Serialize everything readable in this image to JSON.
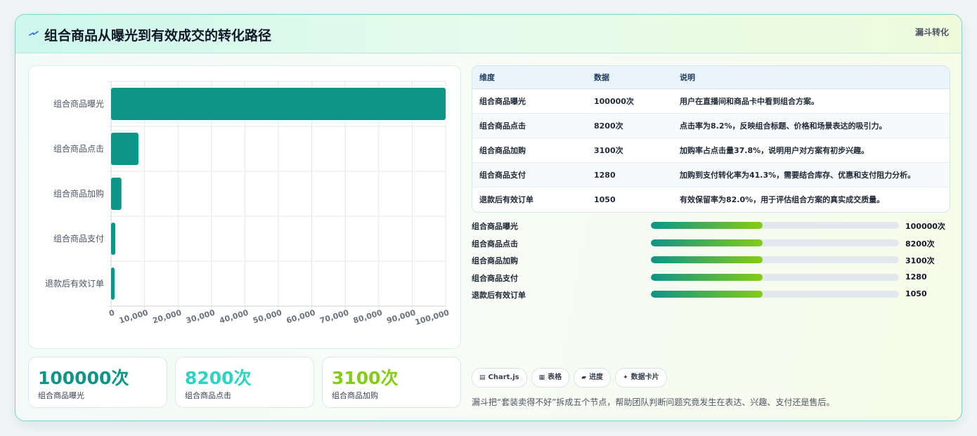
{
  "header": {
    "title": "组合商品从曝光到有效成交的转化路径",
    "badge": "漏斗转化",
    "icon": "spark-icon"
  },
  "colors": {
    "bar": "#0f9488",
    "kpi1": "#0f9488",
    "kpi2": "#2dd4bf",
    "kpi3": "#84cc16",
    "progress_start": "#0f9488",
    "progress_end": "#84cc16"
  },
  "chart_data": {
    "type": "bar",
    "orientation": "horizontal",
    "categories": [
      "组合商品曝光",
      "组合商品点击",
      "组合商品加购",
      "组合商品支付",
      "退款后有效订单"
    ],
    "values": [
      100000,
      8200,
      3100,
      1280,
      1050
    ],
    "xlim": [
      0,
      100000
    ],
    "xticks": [
      0,
      10000,
      20000,
      30000,
      40000,
      50000,
      60000,
      70000,
      80000,
      90000,
      100000
    ],
    "xtick_labels": [
      "0",
      "10,000",
      "20,000",
      "30,000",
      "40,000",
      "50,000",
      "60,000",
      "70,000",
      "80,000",
      "90,000",
      "100,000"
    ],
    "grid": true,
    "title": "",
    "xlabel": "",
    "ylabel": ""
  },
  "kpis": [
    {
      "value": "100000次",
      "label": "组合商品曝光"
    },
    {
      "value": "8200次",
      "label": "组合商品点击"
    },
    {
      "value": "3100次",
      "label": "组合商品加购"
    }
  ],
  "table": {
    "headers": [
      "维度",
      "数据",
      "说明"
    ],
    "rows": [
      [
        "组合商品曝光",
        "100000次",
        "用户在直播间和商品卡中看到组合方案。"
      ],
      [
        "组合商品点击",
        "8200次",
        "点击率为8.2%，反映组合标题、价格和场景表达的吸引力。"
      ],
      [
        "组合商品加购",
        "3100次",
        "加购率占点击量37.8%，说明用户对方案有初步兴趣。"
      ],
      [
        "组合商品支付",
        "1280",
        "加购到支付转化率为41.3%，需要结合库存、优惠和支付阻力分析。"
      ],
      [
        "退款后有效订单",
        "1050",
        "有效保留率为82.0%，用于评估组合方案的真实成交质量。"
      ]
    ]
  },
  "progress": [
    {
      "label": "组合商品曝光",
      "value": "100000次",
      "fill": 0.45
    },
    {
      "label": "组合商品点击",
      "value": "8200次",
      "fill": 0.45
    },
    {
      "label": "组合商品加购",
      "value": "3100次",
      "fill": 0.45
    },
    {
      "label": "组合商品支付",
      "value": "1280",
      "fill": 0.45
    },
    {
      "label": "退款后有效订单",
      "value": "1050",
      "fill": 0.45
    }
  ],
  "chips": [
    {
      "icon": "▤",
      "label": "Chart.js"
    },
    {
      "icon": "▦",
      "label": "表格"
    },
    {
      "icon": "▰",
      "label": "进度"
    },
    {
      "icon": "✦",
      "label": "数据卡片"
    }
  ],
  "footnote": "漏斗把“套装卖得不好”拆成五个节点，帮助团队判断问题究竟发生在表达、兴趣、支付还是售后。"
}
